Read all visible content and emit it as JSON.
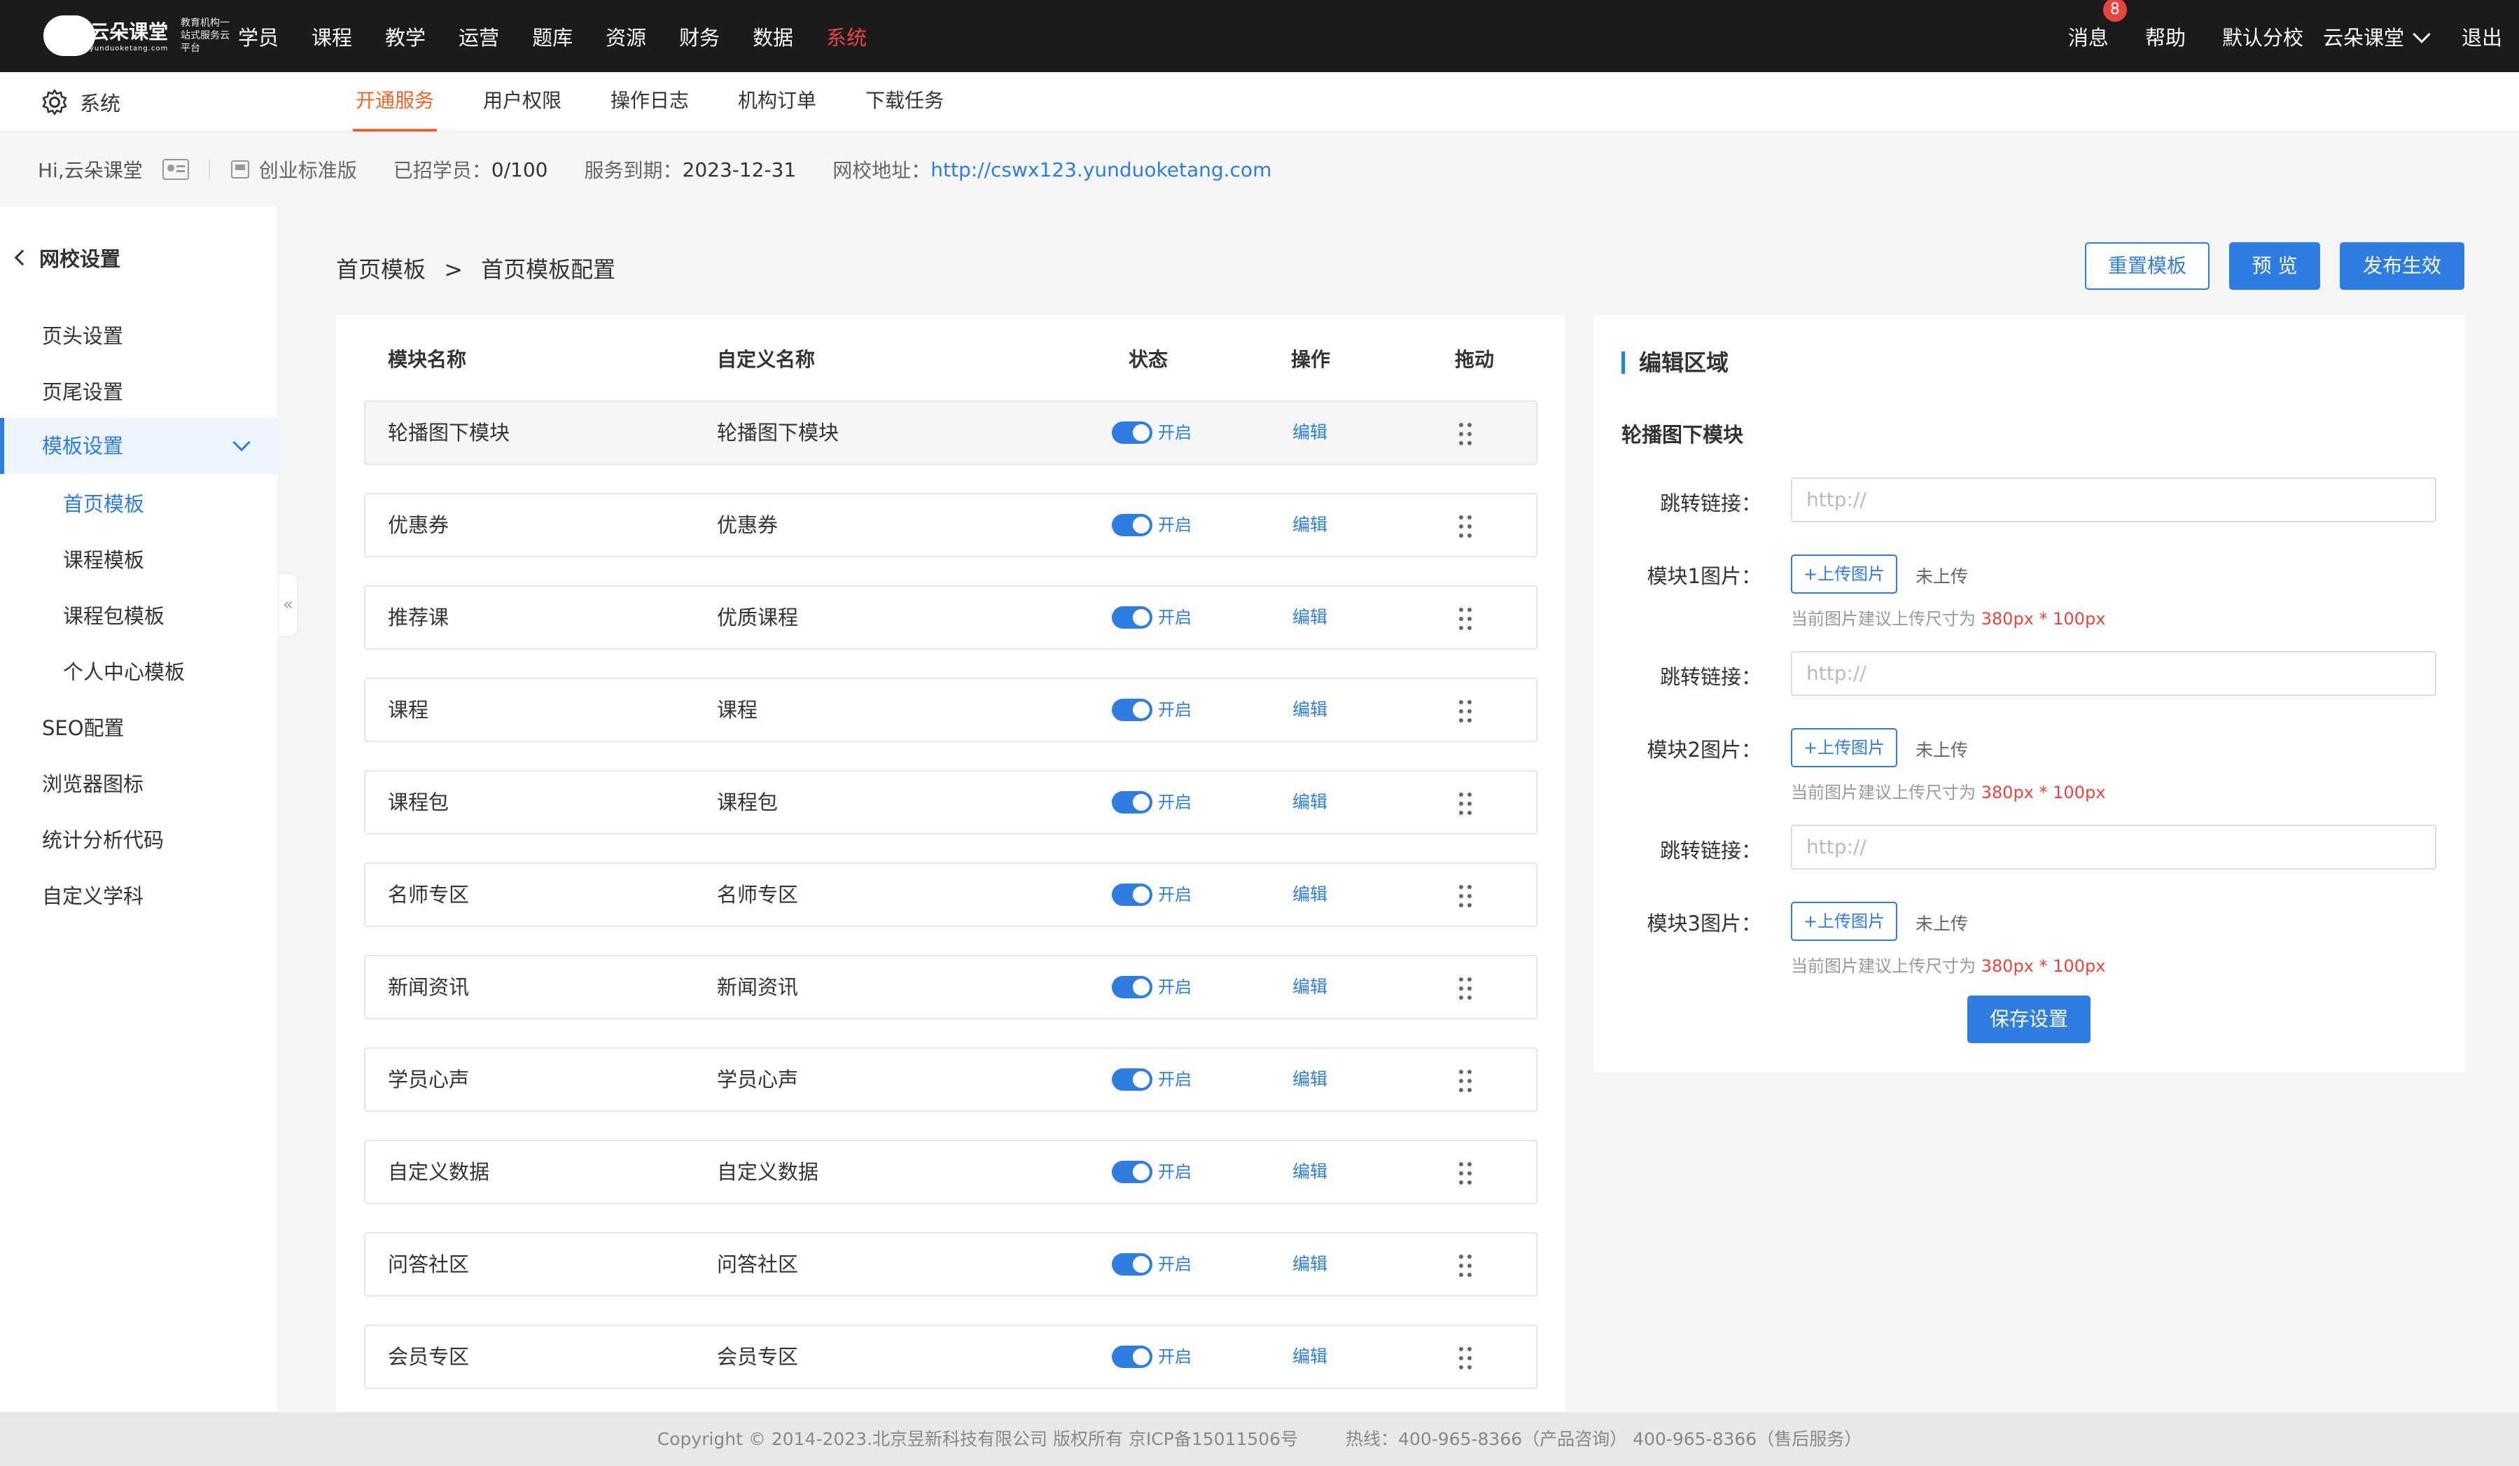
{
  "brand": {
    "name": "云朵课堂",
    "domain": "yunduoketang.com",
    "tagline": "教育机构一站式服务云平台"
  },
  "topnav": {
    "items": [
      "学员",
      "课程",
      "教学",
      "运营",
      "题库",
      "资源",
      "财务",
      "数据",
      "系统"
    ],
    "active": "系统"
  },
  "topright": {
    "messages_label": "消息",
    "messages_badge": "8",
    "help_label": "帮助",
    "branch_label": "默认分校",
    "user_label": "云朵课堂",
    "logout_label": "退出"
  },
  "system": {
    "title": "系统",
    "tabs": [
      "开通服务",
      "用户权限",
      "操作日志",
      "机构订单",
      "下载任务"
    ],
    "active_tab": "开通服务"
  },
  "info": {
    "greeting": "Hi,云朵课堂",
    "edition": "创业标准版",
    "students_label": "已招学员：",
    "students_value": "0/100",
    "expire_label": "服务到期：",
    "expire_value": "2023-12-31",
    "site_label": "网校地址：",
    "site_url": "http://cswx123.yunduoketang.com"
  },
  "sidebar": {
    "back_label": "网校设置",
    "items": [
      "页头设置",
      "页尾设置",
      "模板设置",
      "SEO配置",
      "浏览器图标",
      "统计分析代码",
      "自定义学科"
    ],
    "expanded": "模板设置",
    "sub_items": [
      "首页模板",
      "课程模板",
      "课程包模板",
      "个人中心模板"
    ],
    "active_sub": "首页模板",
    "collapse_icon": "«"
  },
  "breadcrumb": {
    "parent": "首页模板",
    "separator": ">",
    "current": "首页模板配置"
  },
  "actions": {
    "reset": "重置模板",
    "preview": "预 览",
    "publish": "发布生效"
  },
  "table": {
    "headers": [
      "模块名称",
      "自定义名称",
      "状态",
      "操作",
      "拖动"
    ],
    "status_on": "开启",
    "edit_label": "编辑",
    "rows": [
      {
        "module": "轮播图下模块",
        "custom": "轮播图下模块"
      },
      {
        "module": "优惠券",
        "custom": "优惠券"
      },
      {
        "module": "推荐课",
        "custom": "优质课程"
      },
      {
        "module": "课程",
        "custom": "课程"
      },
      {
        "module": "课程包",
        "custom": "课程包"
      },
      {
        "module": "名师专区",
        "custom": "名师专区"
      },
      {
        "module": "新闻资讯",
        "custom": "新闻资讯"
      },
      {
        "module": "学员心声",
        "custom": "学员心声"
      },
      {
        "module": "自定义数据",
        "custom": "自定义数据"
      },
      {
        "module": "问答社区",
        "custom": "问答社区"
      },
      {
        "module": "会员专区",
        "custom": "会员专区"
      }
    ]
  },
  "editor": {
    "title": "编辑区域",
    "module_name": "轮播图下模块",
    "link_label": "跳转链接：",
    "link_placeholder": "http://",
    "blocks": [
      {
        "image_label": "模块1图片：",
        "upload_label": "+上传图片",
        "upload_state": "未上传"
      },
      {
        "image_label": "模块2图片：",
        "upload_label": "+上传图片",
        "upload_state": "未上传"
      },
      {
        "image_label": "模块3图片：",
        "upload_label": "+上传图片",
        "upload_state": "未上传"
      }
    ],
    "hint_prefix": "当前图片建议上传尺寸为",
    "hint_size": "380px * 100px",
    "save_label": "保存设置"
  },
  "footer": {
    "copyright": "Copyright © 2014-2023.北京昱新科技有限公司 版权所有 京ICP备15011506号",
    "hotline": "热线：400-965-8366（产品咨询） 400-965-8366（售后服务）"
  },
  "colors": {
    "accent": "#2f7de1",
    "active_tab": "#f0662a",
    "badge": "#e8463c",
    "topbar": "#1b1b1d"
  }
}
